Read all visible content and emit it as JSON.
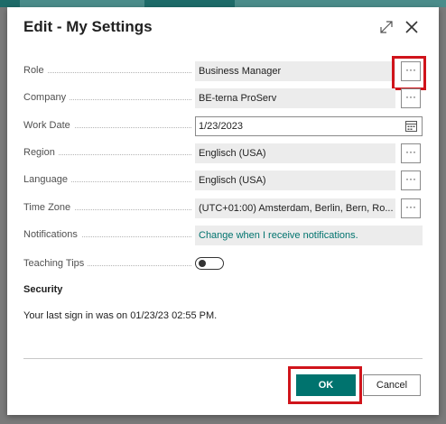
{
  "dialog": {
    "title": "Edit - My Settings"
  },
  "icons": {
    "expand": "expand-icon",
    "close": "close-icon",
    "calendar": "calendar-icon",
    "lookup": "ellipsis-icon"
  },
  "fields": {
    "role": {
      "label": "Role",
      "value": "Business Manager",
      "button": "···"
    },
    "company": {
      "label": "Company",
      "value": "BE-terna ProServ",
      "button": "···"
    },
    "work_date": {
      "label": "Work Date",
      "value": "1/23/2023"
    },
    "region": {
      "label": "Region",
      "value": "Englisch (USA)",
      "button": "···"
    },
    "language": {
      "label": "Language",
      "value": "Englisch (USA)",
      "button": "···"
    },
    "time_zone": {
      "label": "Time Zone",
      "value": "(UTC+01:00) Amsterdam, Berlin, Bern, Ro...",
      "button": "···"
    },
    "notifications": {
      "label": "Notifications",
      "value": "Change when I receive notifications."
    },
    "teaching_tips": {
      "label": "Teaching Tips",
      "enabled": false
    }
  },
  "security": {
    "heading": "Security",
    "last_signin": "Your last sign in was on 01/23/23 02:55 PM."
  },
  "footer": {
    "ok_label": "OK",
    "cancel_label": "Cancel"
  },
  "colors": {
    "accent": "#00736e",
    "highlight": "#d0141b"
  }
}
